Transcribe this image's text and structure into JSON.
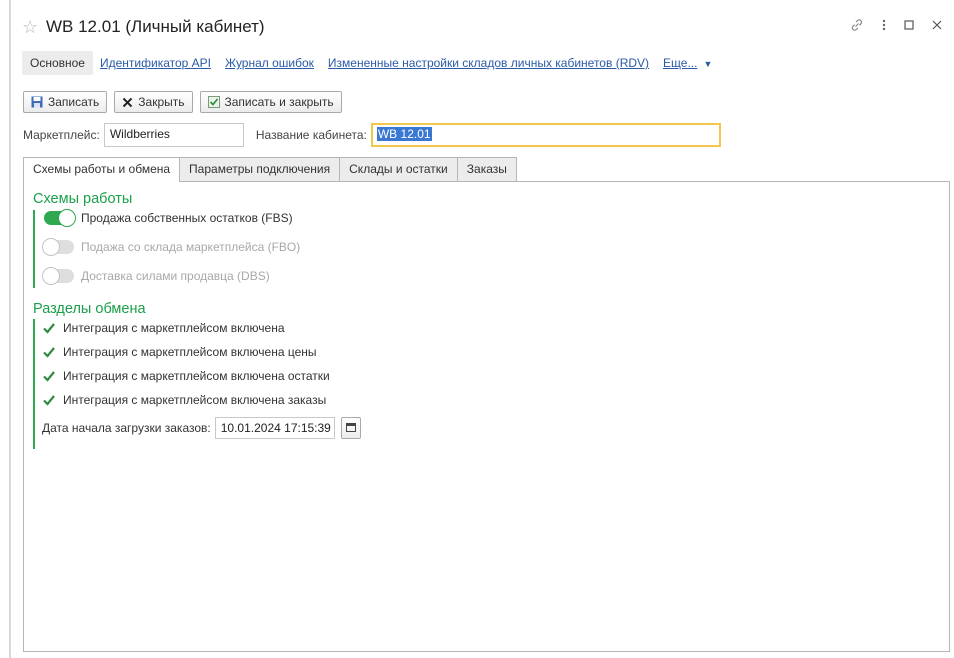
{
  "window": {
    "title": "WB 12.01 (Личный кабинет)",
    "star_icon": "star-icon",
    "controls": [
      "link-icon",
      "more-vertical-icon",
      "maximize-icon",
      "close-icon"
    ]
  },
  "nav": {
    "main": "Основное",
    "links": [
      "Идентификатор API",
      "Журнал ошибок",
      "Измененные настройки складов личных кабинетов (RDV)"
    ],
    "more": "Еще..."
  },
  "toolbar": {
    "save": "Записать",
    "close": "Закрыть",
    "save_close": "Записать и закрыть"
  },
  "fields": {
    "marketplace_label": "Маркетплейс:",
    "marketplace_value": "Wildberries",
    "cabinet_label": "Название кабинета:",
    "cabinet_value": "WB 12.01"
  },
  "tabs": [
    "Схемы работы и обмена",
    "Параметры подключения",
    "Склады и остатки",
    "Заказы"
  ],
  "schemes": {
    "title": "Схемы работы",
    "items": [
      {
        "label": "Продажа собственных остатков (FBS)",
        "on": true
      },
      {
        "label": "Подажа со склада маркетплейса (FBO)",
        "on": false
      },
      {
        "label": "Доставка силами продавца (DBS)",
        "on": false
      }
    ]
  },
  "exchange": {
    "title": "Разделы обмена",
    "items": [
      "Интеграция с маркетплейсом включена",
      "Интеграция с маркетплейсом включена цены",
      "Интеграция с маркетплейсом включена остатки",
      "Интеграция с маркетплейсом включена заказы"
    ],
    "date_label": "Дата начала загрузки заказов:",
    "date_value": "10.01.2024 17:15:39"
  },
  "colors": {
    "accent_green": "#2fa94f",
    "link_blue": "#2a5aa8",
    "focus_yellow": "#f2c84b"
  }
}
